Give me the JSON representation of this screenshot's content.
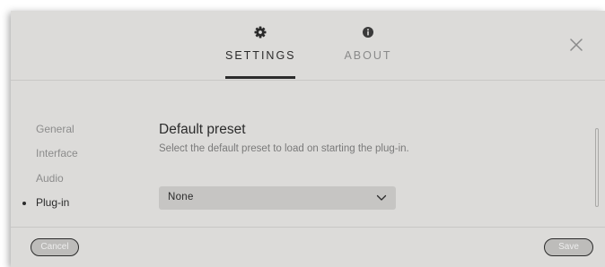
{
  "tabs": [
    {
      "label": "SETTINGS",
      "icon": "gear-icon",
      "active": true
    },
    {
      "label": "ABOUT",
      "icon": "info-icon",
      "active": false
    }
  ],
  "close_icon": "close-icon",
  "sidebar": {
    "items": [
      {
        "label": "General",
        "active": false
      },
      {
        "label": "Interface",
        "active": false
      },
      {
        "label": "Audio",
        "active": false
      },
      {
        "label": "Plug-in",
        "active": true
      }
    ]
  },
  "content": {
    "title": "Default preset",
    "description": "Select the default preset to load on starting the plug-in.",
    "select": {
      "value": "None"
    }
  },
  "footer": {
    "cancel_label": "Cancel",
    "save_label": "Save"
  },
  "colors": {
    "background": "#dcdbd9",
    "text_primary": "#2b2b2b",
    "text_secondary": "#8c8c8c",
    "select_bg": "#c6c5c3"
  }
}
